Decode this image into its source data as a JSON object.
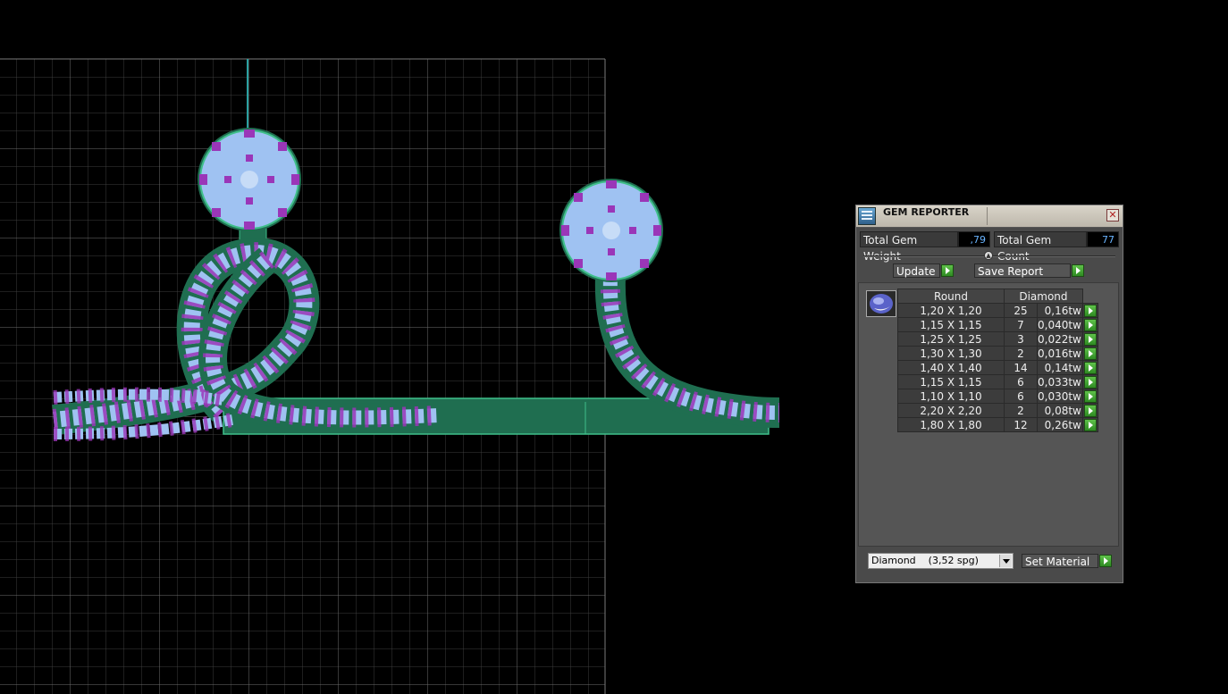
{
  "panel": {
    "title": "GEM REPORTER",
    "total_weight_label": "Total Gem Weight",
    "total_weight_value": ",79",
    "total_count_label": "Total Gem Count",
    "total_count_value": "77",
    "update_label": "Update",
    "save_report_label": "Save Report",
    "table_headers": {
      "shape": "Round",
      "material": "Diamond"
    },
    "rows": [
      {
        "size": "1,20 X 1,20",
        "count": "25",
        "weight": "0,16tw"
      },
      {
        "size": "1,15 X 1,15",
        "count": "7",
        "weight": "0,040tw"
      },
      {
        "size": "1,25 X 1,25",
        "count": "3",
        "weight": "0,022tw"
      },
      {
        "size": "1,30 X 1,30",
        "count": "2",
        "weight": "0,016tw"
      },
      {
        "size": "1,40 X 1,40",
        "count": "14",
        "weight": "0,14tw"
      },
      {
        "size": "1,15 X 1,15",
        "count": "6",
        "weight": "0,033tw"
      },
      {
        "size": "1,10 X 1,10",
        "count": "6",
        "weight": "0,030tw"
      },
      {
        "size": "2,20 X 2,20",
        "count": "2",
        "weight": "0,08tw"
      },
      {
        "size": "1,80 X 1,80",
        "count": "12",
        "weight": "0,26tw"
      }
    ],
    "material_selected": "Diamond    (3,52 spg)",
    "set_material_label": "Set Material"
  },
  "colors": {
    "grid": "#6e6e6e",
    "metal": "#2e8f6a",
    "gem": "#9fc2f2",
    "prong": "#9a36b8"
  }
}
